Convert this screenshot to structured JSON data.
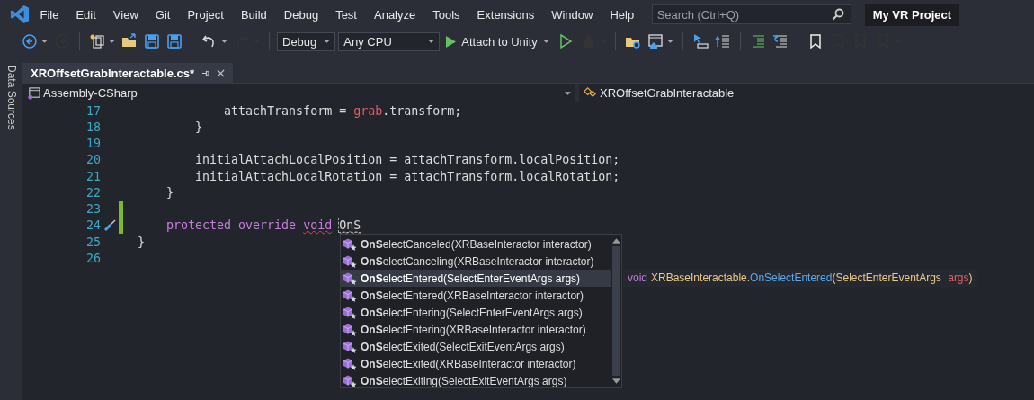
{
  "menu_bar": {
    "items": [
      "File",
      "Edit",
      "View",
      "Git",
      "Project",
      "Build",
      "Debug",
      "Test",
      "Analyze",
      "Tools",
      "Extensions",
      "Window",
      "Help"
    ],
    "search": {
      "placeholder": "Search (Ctrl+Q)"
    },
    "project_name": "My VR Project"
  },
  "toolbar": {
    "items": [
      {
        "kind": "icon",
        "disabled": false,
        "caret": true
      },
      {
        "kind": "icon",
        "disabled": true,
        "caret": false
      },
      {
        "kind": "separator"
      },
      {
        "kind": "icon",
        "disabled": false,
        "caret": true
      },
      {
        "kind": "icon",
        "disabled": false,
        "caret": false
      },
      {
        "kind": "icon",
        "disabled": false,
        "caret": false
      },
      {
        "kind": "icon",
        "disabled": false,
        "caret": false
      },
      {
        "kind": "separator"
      },
      {
        "kind": "icon",
        "disabled": false,
        "caret": true
      },
      {
        "kind": "icon",
        "disabled": true,
        "caret": true
      },
      {
        "kind": "separator"
      },
      {
        "kind": "dropdown",
        "value": "Debug"
      },
      {
        "kind": "dropdown",
        "value": "Any CPU"
      },
      {
        "kind": "run",
        "label": "Attach to Unity"
      },
      {
        "kind": "icon",
        "disabled": false,
        "caret": false
      },
      {
        "kind": "icon",
        "disabled": true,
        "caret": true
      },
      {
        "kind": "separator"
      },
      {
        "kind": "icon",
        "disabled": false,
        "caret": false
      },
      {
        "kind": "icon",
        "disabled": false,
        "caret": true
      },
      {
        "kind": "separator"
      },
      {
        "kind": "icon",
        "disabled": false,
        "caret": false
      },
      {
        "kind": "icon",
        "disabled": false,
        "caret": false
      },
      {
        "kind": "separator"
      },
      {
        "kind": "icon",
        "disabled": false,
        "caret": false
      },
      {
        "kind": "icon",
        "disabled": false,
        "caret": false
      },
      {
        "kind": "separator"
      },
      {
        "kind": "icon",
        "disabled": false,
        "caret": false
      },
      {
        "kind": "icon",
        "disabled": true,
        "caret": false
      },
      {
        "kind": "icon",
        "disabled": true,
        "caret": false
      },
      {
        "kind": "icon",
        "disabled": true,
        "caret": true
      }
    ]
  },
  "side_panel": {
    "label": "Data Sources"
  },
  "tabs": [
    {
      "label": "XROffsetGrabInteractable.cs*",
      "selected": true
    }
  ],
  "navigation_bar": {
    "project": "Assembly-CSharp",
    "type": "XROffsetGrabInteractable"
  },
  "editor": {
    "lines": [
      {
        "number": "17",
        "changed": false,
        "action_icon": false,
        "tokens": [
          {
            "kind": "text",
            "text": "            attachTransform = "
          },
          {
            "kind": "local",
            "text": "grab"
          },
          {
            "kind": "text",
            "text": ".transform;"
          }
        ]
      },
      {
        "number": "18",
        "changed": false,
        "action_icon": false,
        "tokens": [
          {
            "kind": "text",
            "text": "        }"
          }
        ]
      },
      {
        "number": "19",
        "changed": false,
        "action_icon": false
      },
      {
        "number": "20",
        "changed": false,
        "action_icon": false,
        "tokens": [
          {
            "kind": "text",
            "text": "        initialAttachLocalPosition = attachTransform.localPosition;"
          }
        ]
      },
      {
        "number": "21",
        "changed": false,
        "action_icon": false,
        "tokens": [
          {
            "kind": "text",
            "text": "        initialAttachLocalRotation = attachTransform.localRotation;"
          }
        ]
      },
      {
        "number": "22",
        "changed": false,
        "action_icon": false,
        "tokens": [
          {
            "kind": "text",
            "text": "    }"
          }
        ]
      },
      {
        "number": "23",
        "changed": true,
        "action_icon": false
      },
      {
        "number": "24",
        "changed": true,
        "action_icon": true,
        "tokens": [
          {
            "kind": "keyword",
            "text": "    protected override "
          },
          {
            "kind": "keyword",
            "text": "void",
            "error": true
          },
          {
            "kind": "typed",
            "text": "OnS",
            "error": true
          }
        ]
      },
      {
        "number": "25",
        "changed": false,
        "action_icon": false,
        "tokens": [
          {
            "kind": "text",
            "text": "}"
          }
        ]
      },
      {
        "number": "26",
        "changed": false,
        "action_icon": false
      }
    ]
  },
  "completion_list": {
    "items": [
      {
        "label": "**OnS**electCanceled(XRBaseInteractor interactor)",
        "selected": false
      },
      {
        "label": "**OnS**electCanceling(XRBaseInteractor interactor)",
        "selected": false
      },
      {
        "label": "**OnS**electEntered(SelectEnterEventArgs args)",
        "selected": true
      },
      {
        "label": "**OnS**electEntered(XRBaseInteractor interactor)",
        "selected": false
      },
      {
        "label": "**OnS**electEntering(SelectEnterEventArgs args)",
        "selected": false
      },
      {
        "label": "**OnS**electEntering(XRBaseInteractor interactor)",
        "selected": false
      },
      {
        "label": "**OnS**electExited(SelectExitEventArgs args)",
        "selected": false
      },
      {
        "label": "**OnS**electExited(XRBaseInteractor interactor)",
        "selected": false
      },
      {
        "label": "**OnS**electExiting(SelectExitEventArgs args)",
        "selected": false
      }
    ]
  },
  "tooltip": {
    "tokens": [
      {
        "kind": "keyword",
        "text": "void"
      },
      {
        "kind": "type",
        "text": "XRBaseInteractable."
      },
      {
        "kind": "method",
        "text": "OnSelectEntered"
      },
      {
        "kind": "type",
        "text": "(SelectEnterEventArgs "
      },
      {
        "kind": "param",
        "text": "args"
      },
      {
        "kind": "type",
        "text": ")"
      }
    ]
  }
}
